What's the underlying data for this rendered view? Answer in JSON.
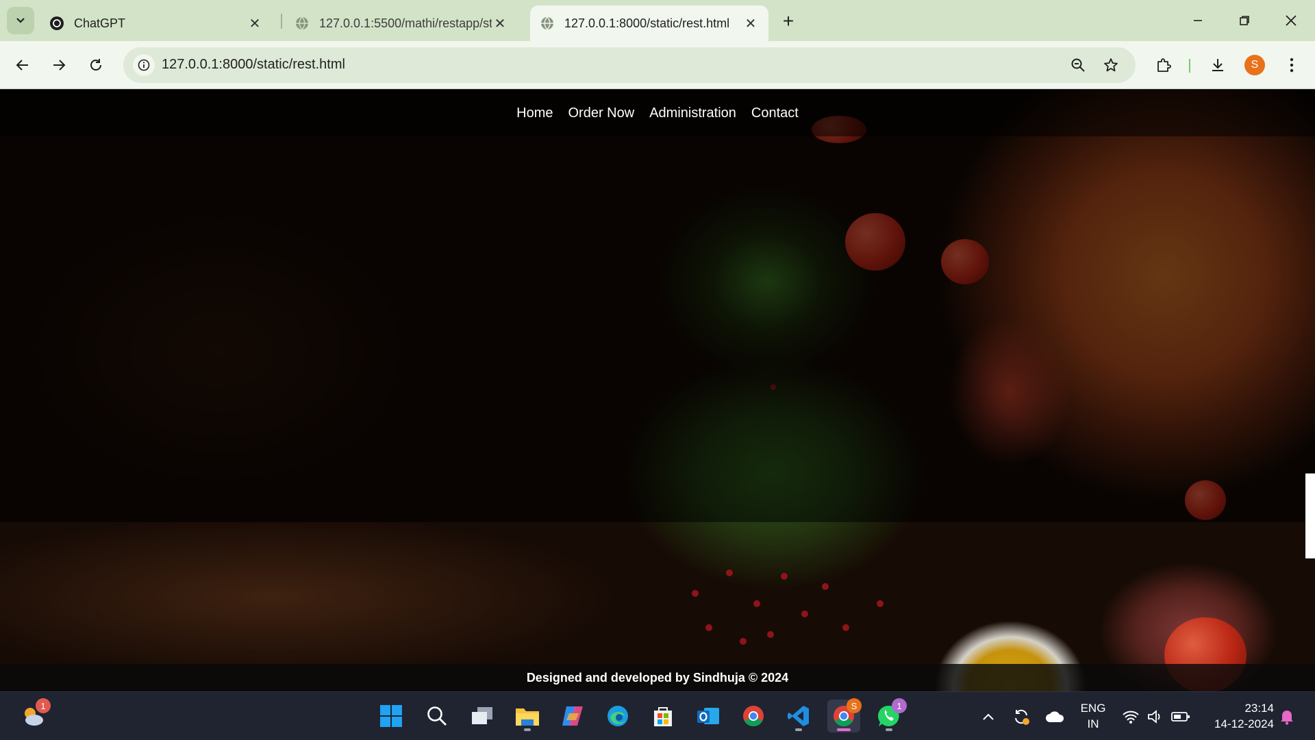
{
  "browser": {
    "tabs": [
      {
        "title": "ChatGPT",
        "icon": "chatgpt-icon"
      },
      {
        "title": "127.0.0.1:5500/mathi/restapp/st",
        "icon": "globe-icon"
      },
      {
        "title": "127.0.0.1:8000/static/rest.html",
        "icon": "globe-icon",
        "active": true
      }
    ],
    "url": "127.0.0.1:8000/static/rest.html",
    "profile_initial": "S"
  },
  "page": {
    "nav": [
      {
        "label": "Home"
      },
      {
        "label": "Order Now"
      },
      {
        "label": "Administration"
      },
      {
        "label": "Contact"
      }
    ],
    "footer": "Designed and developed by Sindhuja © 2024"
  },
  "taskbar": {
    "weather_badge": "1",
    "chrome_profile_badge": "S",
    "whatsapp_badge": "1",
    "lang_top": "ENG",
    "lang_bottom": "IN",
    "time": "23:14",
    "date": "14-12-2024"
  },
  "colors": {
    "tabbar_bg": "#d3e3c7",
    "toolbar_bg": "#f1f6ee",
    "taskbar_bg": "#202431",
    "accent_orange": "#e8711a"
  }
}
